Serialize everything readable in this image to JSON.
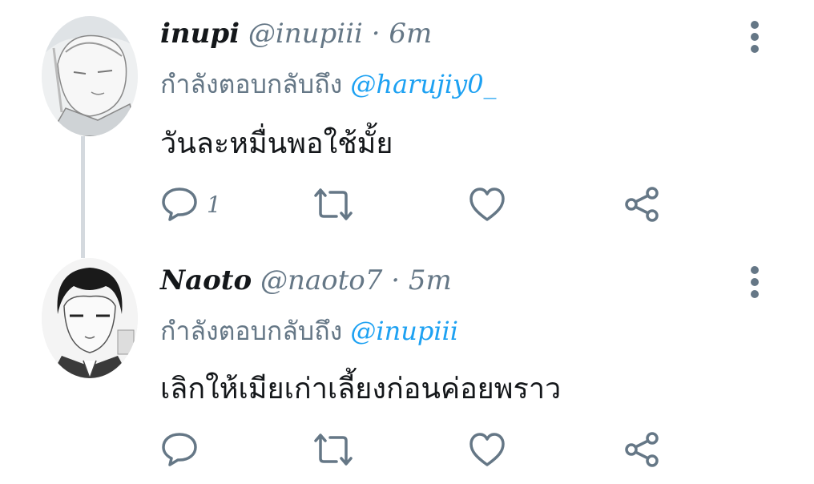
{
  "tweets": [
    {
      "name": "inupi",
      "handle": "@inupiii",
      "separator": " · ",
      "time": "6m",
      "reply_prefix": "กำลังตอบกลับถึง",
      "reply_to": "@harujiy0_",
      "text": "วันละหมื่นพอใช้มั้ย",
      "reply_count": "1",
      "icons": [
        "reply-icon",
        "retweet-icon",
        "like-icon",
        "share-icon",
        "more-icon"
      ]
    },
    {
      "name": "Naoto",
      "handle": "@naoto7",
      "separator": " · ",
      "time": "5m",
      "reply_prefix": "กำลังตอบกลับถึง",
      "reply_to": "@inupiii",
      "text": "เลิกให้เมียเก่าเลี้ยงก่อนค่อยพราว",
      "reply_count": "",
      "icons": [
        "reply-icon",
        "retweet-icon",
        "like-icon",
        "share-icon",
        "more-icon"
      ]
    }
  ],
  "colors": {
    "text": "#14171a",
    "secondary": "#657786",
    "link": "#1da1f2",
    "thread_line": "#d4d9de"
  }
}
